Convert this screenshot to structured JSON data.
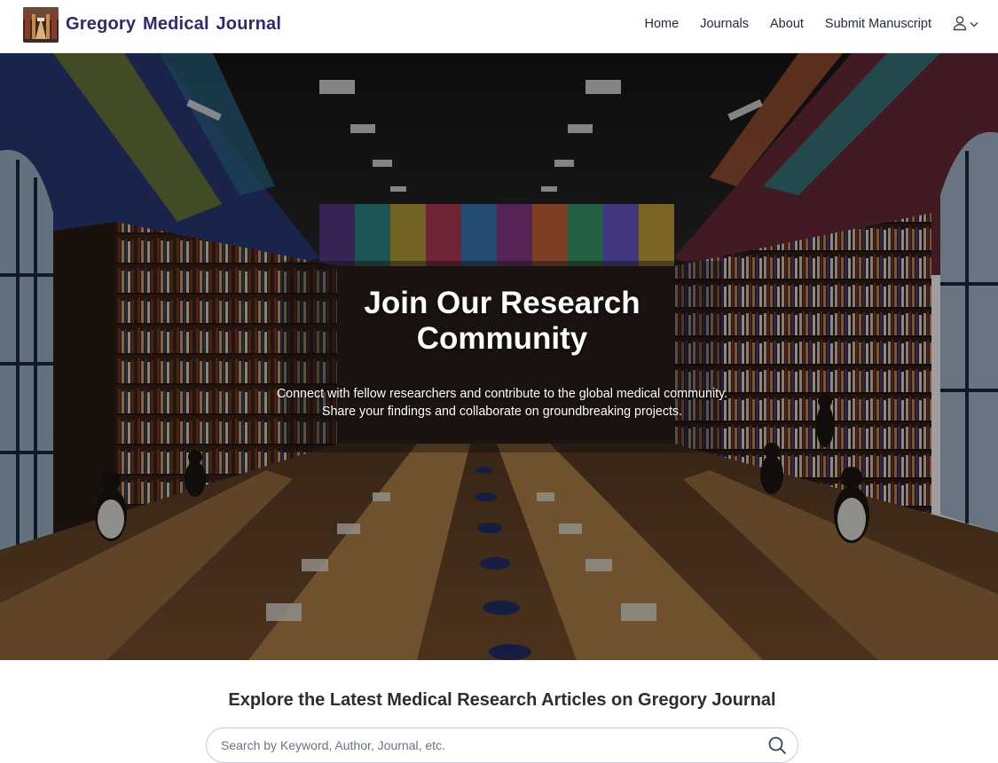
{
  "header": {
    "brand": "Gregory Medical Journal",
    "nav": [
      {
        "label": "Home"
      },
      {
        "label": "Journals"
      },
      {
        "label": "About"
      },
      {
        "label": "Submit Manuscript"
      }
    ],
    "user_menu_icon": "user-icon"
  },
  "hero": {
    "title": "Join Our Research Community",
    "text": "Connect with fellow researchers and contribute to the global medical community. Share your findings and collaborate on groundbreaking projects."
  },
  "explore": {
    "title": "Explore the Latest Medical Research Articles on Gregory Journal",
    "search_placeholder": "Search by Keyword, Author, Journal, etc.",
    "search_value": ""
  },
  "colors": {
    "brand": "#2e2a6b",
    "hero_overlay": "#0f0f0f",
    "text": "#1f2937"
  }
}
